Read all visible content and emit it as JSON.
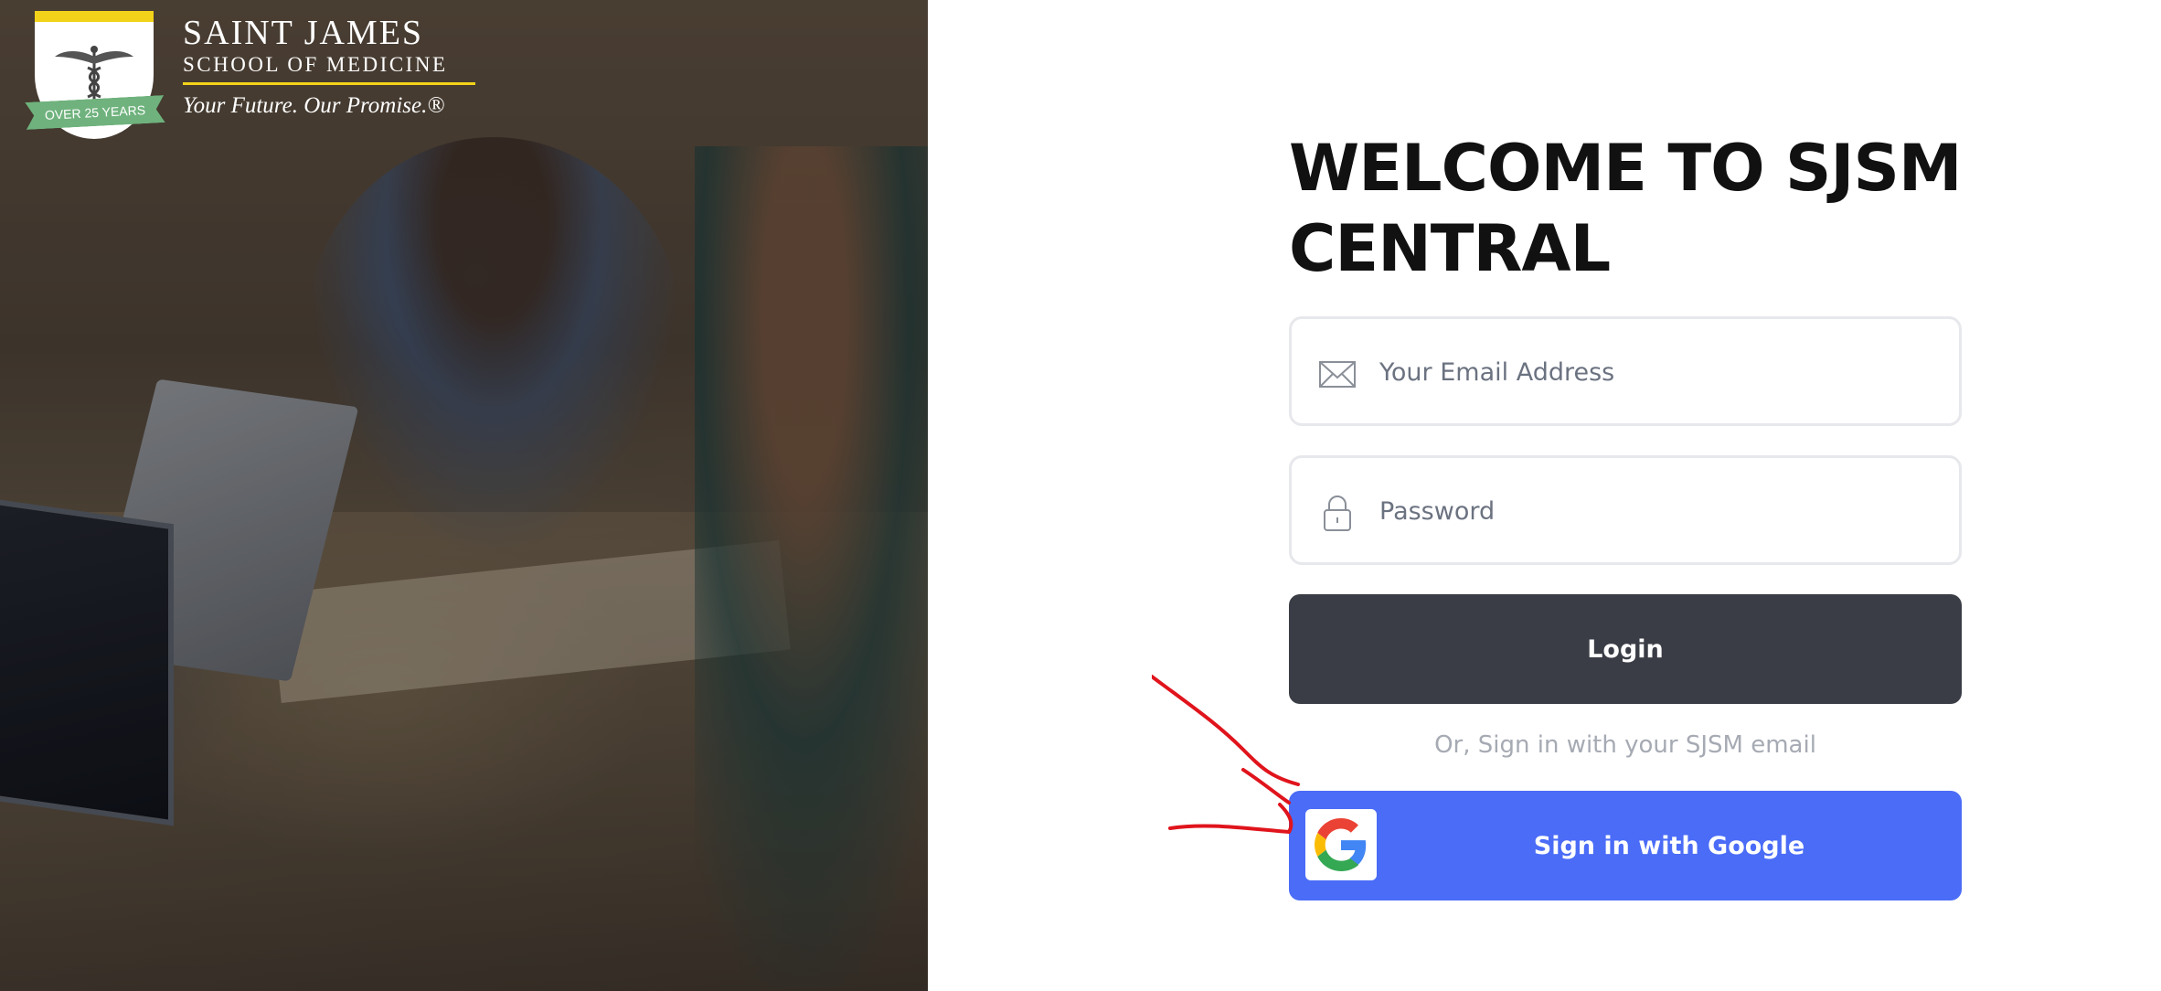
{
  "logo": {
    "title": "SAINT JAMES",
    "subtitle": "SCHOOL OF MEDICINE",
    "tagline": "Your Future. Our Promise.®",
    "badge": "OVER 25 YEARS",
    "icon": "caduceus-icon",
    "colors": {
      "gold": "#f3d21a",
      "green": "#6fb27d"
    }
  },
  "login": {
    "heading": "WELCOME TO SJSM CENTRAL",
    "email": {
      "placeholder": "Your Email Address",
      "value": "",
      "icon": "envelope-icon"
    },
    "password": {
      "placeholder": "Password",
      "value": "",
      "icon": "lock-icon"
    },
    "login_label": "Login",
    "or_text": "Or, Sign in with your SJSM email",
    "google_label": "Sign in with Google",
    "google_icon": "google-icon"
  },
  "colors": {
    "login_button": "#3a3d45",
    "google_button": "#4a6cf7",
    "annotation": "#e0141c"
  }
}
